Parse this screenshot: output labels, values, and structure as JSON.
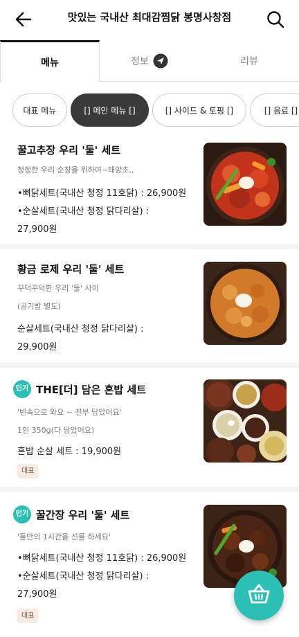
{
  "header": {
    "title": "맛있는 국내산 최대감찜닭 봉명사창점",
    "back_icon": "back-arrow-icon",
    "search_icon": "search-icon"
  },
  "tabs": [
    {
      "label": "메뉴",
      "active": true
    },
    {
      "label": "정보",
      "active": false,
      "icon": "navigation-icon"
    },
    {
      "label": "리뷰",
      "active": false
    }
  ],
  "categories": [
    {
      "label": "대표 메뉴",
      "active": false
    },
    {
      "label": "[] 메인 메뉴 []",
      "active": true
    },
    {
      "label": "[] 사이드 & 토핑 []",
      "active": false
    },
    {
      "label": "[] 음료 []",
      "active": false
    }
  ],
  "menu_items": [
    {
      "name": "꿀고추장 우리 '둘' 세트",
      "hot": false,
      "desc": [
        "청정한 우리 순창을 위하여~태양초,,"
      ],
      "price": [
        "•뼈닭세트(국내산 청정 11호닭) : 26,900원",
        "•순살세트(국내산 청정 닭다리살) :",
        "27,900원"
      ],
      "tag": ""
    },
    {
      "name": "황금 로제 우리 '둘' 세트",
      "hot": false,
      "desc": [
        "꾸덕꾸덕한 우리 '둘' 사이",
        "(공기밥 별도)"
      ],
      "price": [
        "순살세트(국내산 청정 닭다리살) :",
        "29,900원"
      ],
      "tag": ""
    },
    {
      "name": "THE[더] 담은 혼밥 세트",
      "hot": true,
      "hot_label": "인기",
      "desc": [
        "'빈속으로 와요 ~ 전부 담았어요'",
        "1인 350g(다 담았어요)"
      ],
      "price": [
        "혼밥 순살 세트 : 19,900원"
      ],
      "tag": "대표"
    },
    {
      "name": "꿀간장 우리 '둘' 세트",
      "hot": true,
      "hot_label": "인기",
      "desc": [
        "'둘만의 1시간을 선물 하세요'"
      ],
      "price": [
        "•뼈닭세트(국내산 청정 11호닭) : 26,900원",
        "•순살세트(국내산 청정 닭다리살) :",
        "27,900원"
      ],
      "tag": "대표"
    }
  ],
  "cart_icon": "shopping-basket-icon",
  "colors": {
    "accent": "#2bbfb5",
    "chip_active": "#3a3a3a",
    "tag_bg": "#f6ece4"
  }
}
